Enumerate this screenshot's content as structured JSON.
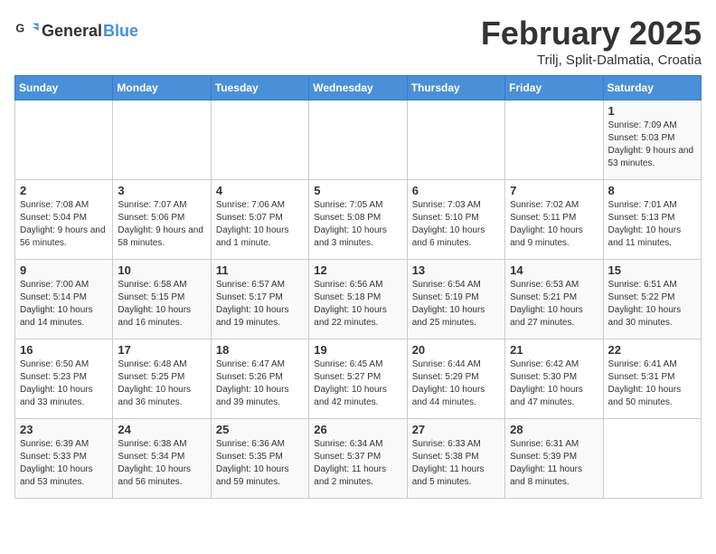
{
  "header": {
    "logo_text_general": "General",
    "logo_text_blue": "Blue",
    "month": "February 2025",
    "location": "Trilj, Split-Dalmatia, Croatia"
  },
  "weekdays": [
    "Sunday",
    "Monday",
    "Tuesday",
    "Wednesday",
    "Thursday",
    "Friday",
    "Saturday"
  ],
  "weeks": [
    [
      {
        "day": "",
        "info": ""
      },
      {
        "day": "",
        "info": ""
      },
      {
        "day": "",
        "info": ""
      },
      {
        "day": "",
        "info": ""
      },
      {
        "day": "",
        "info": ""
      },
      {
        "day": "",
        "info": ""
      },
      {
        "day": "1",
        "info": "Sunrise: 7:09 AM\nSunset: 5:03 PM\nDaylight: 9 hours and 53 minutes."
      }
    ],
    [
      {
        "day": "2",
        "info": "Sunrise: 7:08 AM\nSunset: 5:04 PM\nDaylight: 9 hours and 56 minutes."
      },
      {
        "day": "3",
        "info": "Sunrise: 7:07 AM\nSunset: 5:06 PM\nDaylight: 9 hours and 58 minutes."
      },
      {
        "day": "4",
        "info": "Sunrise: 7:06 AM\nSunset: 5:07 PM\nDaylight: 10 hours and 1 minute."
      },
      {
        "day": "5",
        "info": "Sunrise: 7:05 AM\nSunset: 5:08 PM\nDaylight: 10 hours and 3 minutes."
      },
      {
        "day": "6",
        "info": "Sunrise: 7:03 AM\nSunset: 5:10 PM\nDaylight: 10 hours and 6 minutes."
      },
      {
        "day": "7",
        "info": "Sunrise: 7:02 AM\nSunset: 5:11 PM\nDaylight: 10 hours and 9 minutes."
      },
      {
        "day": "8",
        "info": "Sunrise: 7:01 AM\nSunset: 5:13 PM\nDaylight: 10 hours and 11 minutes."
      }
    ],
    [
      {
        "day": "9",
        "info": "Sunrise: 7:00 AM\nSunset: 5:14 PM\nDaylight: 10 hours and 14 minutes."
      },
      {
        "day": "10",
        "info": "Sunrise: 6:58 AM\nSunset: 5:15 PM\nDaylight: 10 hours and 16 minutes."
      },
      {
        "day": "11",
        "info": "Sunrise: 6:57 AM\nSunset: 5:17 PM\nDaylight: 10 hours and 19 minutes."
      },
      {
        "day": "12",
        "info": "Sunrise: 6:56 AM\nSunset: 5:18 PM\nDaylight: 10 hours and 22 minutes."
      },
      {
        "day": "13",
        "info": "Sunrise: 6:54 AM\nSunset: 5:19 PM\nDaylight: 10 hours and 25 minutes."
      },
      {
        "day": "14",
        "info": "Sunrise: 6:53 AM\nSunset: 5:21 PM\nDaylight: 10 hours and 27 minutes."
      },
      {
        "day": "15",
        "info": "Sunrise: 6:51 AM\nSunset: 5:22 PM\nDaylight: 10 hours and 30 minutes."
      }
    ],
    [
      {
        "day": "16",
        "info": "Sunrise: 6:50 AM\nSunset: 5:23 PM\nDaylight: 10 hours and 33 minutes."
      },
      {
        "day": "17",
        "info": "Sunrise: 6:48 AM\nSunset: 5:25 PM\nDaylight: 10 hours and 36 minutes."
      },
      {
        "day": "18",
        "info": "Sunrise: 6:47 AM\nSunset: 5:26 PM\nDaylight: 10 hours and 39 minutes."
      },
      {
        "day": "19",
        "info": "Sunrise: 6:45 AM\nSunset: 5:27 PM\nDaylight: 10 hours and 42 minutes."
      },
      {
        "day": "20",
        "info": "Sunrise: 6:44 AM\nSunset: 5:29 PM\nDaylight: 10 hours and 44 minutes."
      },
      {
        "day": "21",
        "info": "Sunrise: 6:42 AM\nSunset: 5:30 PM\nDaylight: 10 hours and 47 minutes."
      },
      {
        "day": "22",
        "info": "Sunrise: 6:41 AM\nSunset: 5:31 PM\nDaylight: 10 hours and 50 minutes."
      }
    ],
    [
      {
        "day": "23",
        "info": "Sunrise: 6:39 AM\nSunset: 5:33 PM\nDaylight: 10 hours and 53 minutes."
      },
      {
        "day": "24",
        "info": "Sunrise: 6:38 AM\nSunset: 5:34 PM\nDaylight: 10 hours and 56 minutes."
      },
      {
        "day": "25",
        "info": "Sunrise: 6:36 AM\nSunset: 5:35 PM\nDaylight: 10 hours and 59 minutes."
      },
      {
        "day": "26",
        "info": "Sunrise: 6:34 AM\nSunset: 5:37 PM\nDaylight: 11 hours and 2 minutes."
      },
      {
        "day": "27",
        "info": "Sunrise: 6:33 AM\nSunset: 5:38 PM\nDaylight: 11 hours and 5 minutes."
      },
      {
        "day": "28",
        "info": "Sunrise: 6:31 AM\nSunset: 5:39 PM\nDaylight: 11 hours and 8 minutes."
      },
      {
        "day": "",
        "info": ""
      }
    ]
  ]
}
